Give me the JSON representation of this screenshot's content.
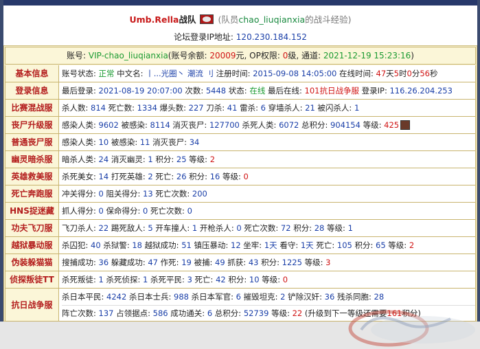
{
  "header": {
    "team": "Umb.Rella",
    "team_suffix": "战队",
    "member_prefix": "(队员",
    "player": "chao_liuqianxia",
    "member_suffix": "的战斗经验)",
    "ip_label": "论坛登录IP地址:",
    "ip": "120.230.184.152"
  },
  "account": {
    "pre": "账号: ",
    "vip": "VIP-chao_liuqianxia",
    "bal_pre": "(账号余额: ",
    "balance": "20009",
    "bal_post": "元, OP权限: ",
    "op": "0",
    "op_post": "级, 通道: ",
    "date": "2021-12-19 15:23:16",
    "close": ")"
  },
  "rows": {
    "basic": {
      "label": "基本信息",
      "t1": "账号状态: ",
      "status": "正常",
      "t2": " 中文名: ",
      "cname": "丨...光圈丶 潮流 刂",
      "t3": " 注册时间: ",
      "reg": "2015-09-08 14:05:00",
      "t4": " 在线时间: ",
      "h": "47",
      "t5": "天",
      "m": "5",
      "t6": "时",
      "s1": "0",
      "t7": "分",
      "s2": "56",
      "t8": "秒"
    },
    "login": {
      "label": "登录信息",
      "t1": "最后登录: ",
      "last": "2021-08-19 20:07:00",
      "t2": " 次数: ",
      "count": "5448",
      "t3": " 状态: ",
      "state": "在线",
      "t4": " 最后在线: ",
      "server": "101抗日战争服",
      "t5": " 登录IP: ",
      "ip": "116.26.204.253"
    },
    "mixed": {
      "label": "比赛混战服",
      "t1": "杀人数: ",
      "v1": "814",
      "t2": " 死亡数: ",
      "v2": "1334",
      "t3": " 爆头数: ",
      "v3": "227",
      "t4": " 刀杀: ",
      "v4": "41",
      "t5": " 雷杀: ",
      "v5": "6",
      "t6": " 穿墙杀人: ",
      "v6": "21",
      "t7": " 被闪杀人: ",
      "v7": "1"
    },
    "zombie_up": {
      "label": "丧尸升级服",
      "t1": "感染人类: ",
      "v1": "9602",
      "t2": " 被感染: ",
      "v2": "8114",
      "t3": " 消灭丧尸: ",
      "v3": "127700",
      "t4": " 杀死人类: ",
      "v4": "6072",
      "t5": " 总积分: ",
      "v5": "904154",
      "t6": " 等级: ",
      "v6": "425"
    },
    "zombie": {
      "label": "普通丧尸服",
      "t1": "感染人类: ",
      "v1": "10",
      "t2": " 被感染: ",
      "v2": "11",
      "t3": " 消灭丧尸: ",
      "v3": "34"
    },
    "ghost": {
      "label": "幽灵暗杀服",
      "t1": "暗杀人类: ",
      "v1": "24",
      "t2": " 消灭幽灵: ",
      "v2": "1",
      "t3": " 积分: ",
      "v3": "25",
      "t4": " 等级: ",
      "v4": "2"
    },
    "hero": {
      "label": "英雄救美服",
      "t1": "杀死美女: ",
      "v1": "14",
      "t2": " 打死英雄: ",
      "v2": "2",
      "t3": " 死亡: ",
      "v3": "26",
      "t4": " 积分: ",
      "v4": "16",
      "t5": " 等级: ",
      "v5": "0"
    },
    "death": {
      "label": "死亡奔跑服",
      "t1": "冲关得分: ",
      "v1": "0",
      "t2": " 阻关得分: ",
      "v2": "13",
      "t3": " 死亡次数: ",
      "v3": "200"
    },
    "hns": {
      "label": "HNS捉迷藏",
      "t1": "抓人得分: ",
      "v1": "0",
      "t2": " 保命得分: ",
      "v2": "0",
      "t3": " 死亡次数: ",
      "v3": "0"
    },
    "kungfu": {
      "label": "功夫飞刀服",
      "t1": "飞刀杀人: ",
      "v1": "22",
      "t2": " 踢死敌人: ",
      "v2": "5",
      "t3": " 开车撞人: ",
      "v3": "1",
      "t4": " 开枪杀人: ",
      "v4": "0",
      "t5": " 死亡次数: ",
      "v5": "72",
      "t6": " 积分: ",
      "v6": "28",
      "t7": " 等级: ",
      "v7": "1"
    },
    "jail": {
      "label": "越狱暴动服",
      "t1": "杀囚犯: ",
      "v1": "40",
      "t2": " 杀狱警: ",
      "v2": "18",
      "t3": " 越狱成功: ",
      "v3": "51",
      "t4": " 镇压暴动: ",
      "v4": "12",
      "t5": " 坐牢: ",
      "v5": "1天",
      "t6": " 看守: ",
      "v6": "1天",
      "t7": " 死亡: ",
      "v7": "105",
      "t8": " 积分: ",
      "v8": "65",
      "t9": " 等级: ",
      "v9": "2"
    },
    "hide": {
      "label": "伪装躲猫猫",
      "t1": "搜捕成功: ",
      "v1": "36",
      "t2": " 躲藏成功: ",
      "v2": "47",
      "t3": " 作死: ",
      "v3": "19",
      "t4": " 被捕: ",
      "v4": "49",
      "t5": " 抓获: ",
      "v5": "43",
      "t6": " 积分: ",
      "v6": "1225",
      "t7": " 等级: ",
      "v7": "3"
    },
    "detective": {
      "label": "侦探叛徒TT",
      "t1": "杀死叛徒: ",
      "v1": "1",
      "t2": " 杀死侦探: ",
      "v2": "1",
      "t3": " 杀死平民: ",
      "v3": "3",
      "t4": " 死亡: ",
      "v4": "42",
      "t5": " 积分: ",
      "v5": "10",
      "t6": " 等级: ",
      "v6": "0"
    },
    "war": {
      "label": "抗日战争服",
      "a1": "杀日本平民: ",
      "av1": "4242",
      "a2": " 杀日本士兵: ",
      "av2": "988",
      "a3": " 杀日本军官: ",
      "av3": "6",
      "a4": " 摧毁坦克: ",
      "av4": "2",
      "a5": " 铲除汉奸: ",
      "av5": "36",
      "a6": " 残杀同胞: ",
      "av6": "28",
      "b1": "阵亡次数: ",
      "bv1": "137",
      "b2": " 占领据点: ",
      "bv2": "586",
      "b3": " 成功通关: ",
      "bv3": "6",
      "b4": " 总积分: ",
      "bv4": "52739",
      "b5": " 等级: ",
      "bv5": "22",
      "b6": " (升级到下一等级还需要",
      "bv6": "161",
      "b7": "积分)"
    }
  },
  "colors": {
    "label_red": "#b31c1c",
    "value_blue": "#1a3fa8",
    "green": "#1a9a30",
    "panel_bg": "#fbf6d8"
  }
}
